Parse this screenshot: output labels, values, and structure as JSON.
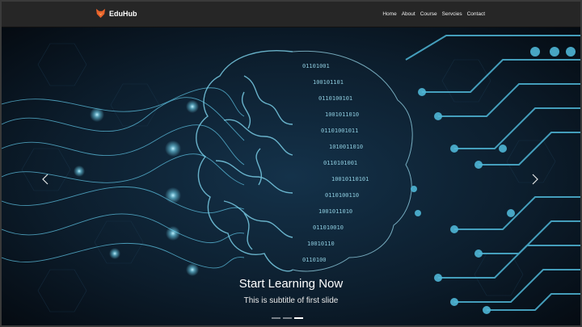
{
  "navbar": {
    "brand": "EduHub",
    "links": [
      "Home",
      "About",
      "Course",
      "Servcies",
      "Contact"
    ]
  },
  "carousel": {
    "slides": [
      {
        "title": "Start Learning Now",
        "subtitle": "This is subtitle of first slide"
      }
    ],
    "indicator_count": 3,
    "active_index": 0,
    "prev_icon": "chevron-left-icon",
    "next_icon": "chevron-right-icon"
  },
  "colors": {
    "navbar_bg": "#262626",
    "hero_bg": "#0b1622",
    "accent_glow": "#6fd3ee",
    "logo_orange": "#e8622a"
  }
}
